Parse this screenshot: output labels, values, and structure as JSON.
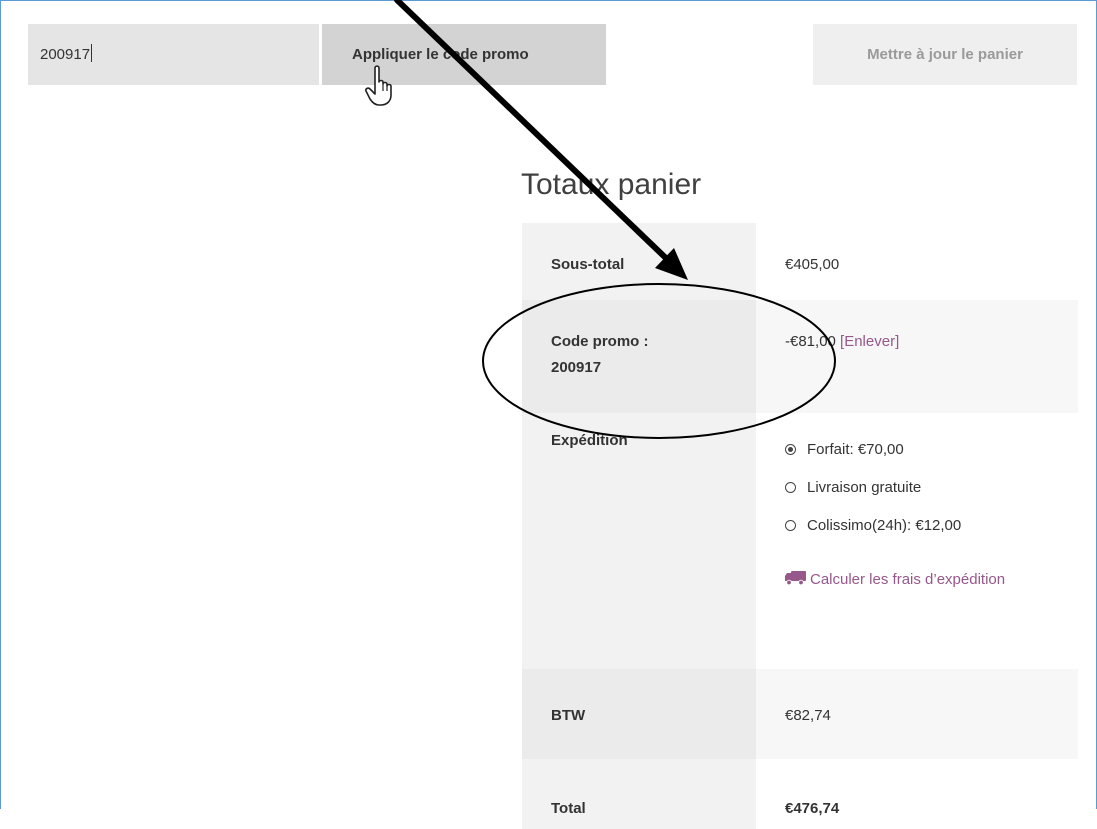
{
  "coupon": {
    "value": "200917",
    "apply_label": "Appliquer le code promo",
    "update_label": "Mettre à jour le panier"
  },
  "totals": {
    "title": "Totaux panier",
    "subtotal": {
      "label": "Sous-total",
      "value": "€405,00"
    },
    "promo": {
      "label_line1": "Code promo :",
      "label_line2": "200917",
      "value": "-€81,00",
      "remove_label": "[Enlever]"
    },
    "shipping": {
      "label": "Expédition",
      "options": [
        {
          "label": "Forfait: €70,00",
          "selected": true
        },
        {
          "label": "Livraison gratuite",
          "selected": false
        },
        {
          "label": "Colissimo(24h): €12,00",
          "selected": false
        }
      ],
      "calc_label": "Calculer les frais d’expédition",
      "calc_icon": "truck-icon"
    },
    "btw": {
      "label": "BTW",
      "value": "€82,74"
    },
    "total": {
      "label": "Total",
      "value": "€476,74"
    }
  },
  "colors": {
    "link": "#96588a",
    "frame_border": "#5b9bd5",
    "apply_bg": "#d3d3d3",
    "update_text": "#9a9a9a"
  },
  "icons": [
    "hand-pointer-icon",
    "truck-icon",
    "annotation-arrow",
    "annotation-ellipse"
  ]
}
